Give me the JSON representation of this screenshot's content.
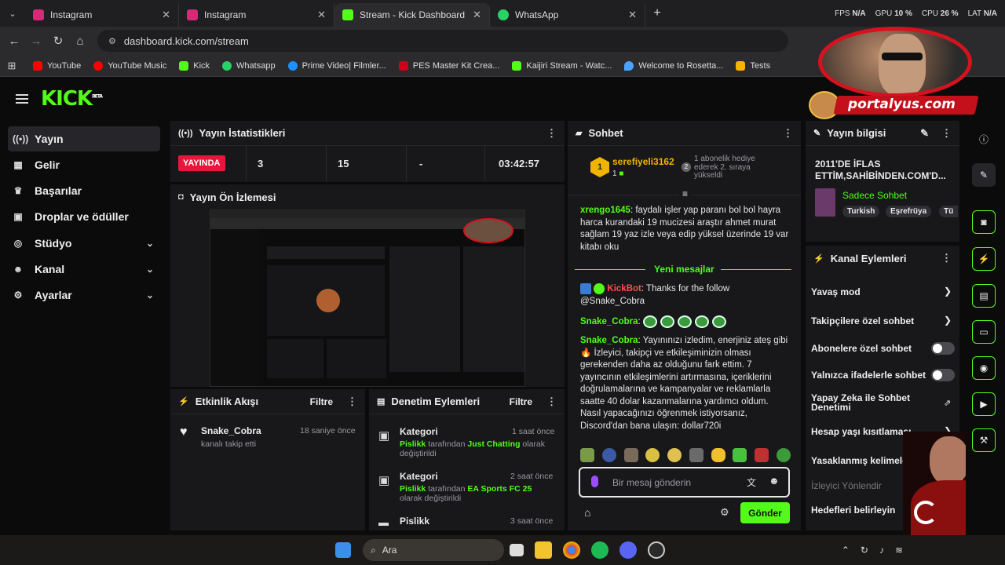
{
  "tabs": [
    {
      "label": "Instagram",
      "color": "#d62976"
    },
    {
      "label": "Instagram",
      "color": "#d62976"
    },
    {
      "label": "Stream - Kick Dashboard",
      "color": "#53fc18"
    },
    {
      "label": "WhatsApp",
      "color": "#25d366"
    }
  ],
  "system": {
    "fps_label": "FPS",
    "fps_value": "N/A",
    "gpu_label": "GPU",
    "gpu_value": "10 %",
    "cpu_label": "CPU",
    "cpu_value": "26 %",
    "lat_label": "LAT",
    "lat_value": "N/A"
  },
  "address": {
    "url": "dashboard.kick.com/stream"
  },
  "bookmarks": [
    {
      "label": "YouTube",
      "color": "#ff0000"
    },
    {
      "label": "YouTube Music",
      "color": "#ff0000"
    },
    {
      "label": "Kick",
      "color": "#53fc18"
    },
    {
      "label": "Whatsapp",
      "color": "#25d366"
    },
    {
      "label": "Prime Video| Filmler...",
      "color": "#1e90ff"
    },
    {
      "label": "PES Master Kit Crea...",
      "color": "#d0021b"
    },
    {
      "label": "Kaijiri Stream - Watc...",
      "color": "#53fc18"
    },
    {
      "label": "Welcome to Rosetta...",
      "color": "#4aa3ff"
    },
    {
      "label": "Tests",
      "color": "#f4b400"
    }
  ],
  "kick": {
    "logo": "KICK",
    "beta": "BETA"
  },
  "watermark": "portalyus.com",
  "sidebar": [
    {
      "label": "Yayın",
      "icon": "broadcast-icon",
      "glyph": "((•))",
      "chev": ""
    },
    {
      "label": "Gelir",
      "icon": "chart-icon",
      "glyph": "▦",
      "chev": ""
    },
    {
      "label": "Başarılar",
      "icon": "trophy-icon",
      "glyph": "🏆",
      "chev": ""
    },
    {
      "label": "Droplar ve ödüller",
      "icon": "gift-icon",
      "glyph": "▣",
      "chev": ""
    },
    {
      "label": "Stüdyo",
      "icon": "studio-icon",
      "glyph": "◎",
      "chev": "⌄"
    },
    {
      "label": "Kanal",
      "icon": "people-icon",
      "glyph": "👥",
      "chev": "⌄"
    },
    {
      "label": "Ayarlar",
      "icon": "gear-icon",
      "glyph": "⚙",
      "chev": "⌄"
    }
  ],
  "stats": {
    "title": "Yayın İstatistikleri",
    "status": "YAYINDA",
    "viewers": "3",
    "followers": "15",
    "subs": "-",
    "duration": "03:42:57"
  },
  "preview": {
    "title": "Yayın Ön İzlemesi"
  },
  "activity": {
    "title": "Etkinlik Akışı",
    "filter": "Filtre",
    "user": "Snake_Cobra",
    "action": "kanalı takip etti",
    "time": "18 saniye önce"
  },
  "moderation": {
    "title": "Denetim Eylemleri",
    "filter": "Filtre",
    "items": [
      {
        "title": "Kategori",
        "time": "1 saat önce",
        "actor": "Pislikk",
        "mid": " tarafından ",
        "target": "Just Chatting",
        "tail": " olarak",
        "line2": "değiştirildi"
      },
      {
        "title": "Kategori",
        "time": "2 saat önce",
        "actor": "Pislikk",
        "mid": " tarafından ",
        "target": "EA Sports FC 25",
        "tail": "",
        "line2": "olarak değiştirildi"
      },
      {
        "title": "Pislikk",
        "time": "3 saat önce"
      }
    ]
  },
  "chat": {
    "title": "Sohbet",
    "pinned_user": "serefiyeli3162",
    "pinned_count": "1",
    "pinned_badge": "2",
    "pinned_text": "1 abonelik hediye ederek 2. sıraya yükseldi",
    "msg1_user": "xrengo1645",
    "msg1_text": ": faydalı işler yap paranı bol bol hayra harca kurandaki 19 mucizesi araştır ahmet murat sağlam 19 yaz izle veya edip yüksel üzerinde 19 var kitabı oku",
    "new_messages": "Yeni mesajlar",
    "bot_user": "KickBot",
    "bot_text": ": Thanks for the follow @Snake_Cobra",
    "msg2_user": "Snake_Cobra",
    "msg3_user": "Snake_Cobra",
    "msg3_text": ": Yayınınızı izledim, enerjiniz ateş gibi 🔥 İzleyici, takipçi ve etkileşiminizin olması gerekenden daha az olduğunu fark ettim. 7 yayıncının etkileşimlerini artırmasına, içeriklerini doğrulamalarına ve kampanyalar ve reklamlarla saatte 40 dolar kazanmalarına yardımcı oldum. Nasıl yapacağınızı öğrenmek istiyorsanız, Discord'dan bana ulaşın: dollar720i",
    "placeholder": "Bir mesaj gönderin",
    "send": "Gönder"
  },
  "stream_info": {
    "title": "Yayın bilgisi",
    "stream_title": "2011'DE İFLAS ETTİM,SAHİBİNDEN.COM'D...",
    "category": "Sadece Sohbet",
    "tags": [
      "Turkish",
      "Eşrefrüya",
      "Tü"
    ]
  },
  "channel_actions": {
    "title": "Kanal Eylemleri",
    "items": [
      {
        "label": "Yavaş mod",
        "control": "chevron"
      },
      {
        "label": "Takipçilere özel sohbet",
        "control": "chevron"
      },
      {
        "label": "Abonelere özel sohbet",
        "control": "toggle"
      },
      {
        "label": "Yalnızca ifadelerle sohbet",
        "control": "toggle"
      },
      {
        "label": "Yapay Zeka ile Sohbet Denetimi",
        "control": "external"
      },
      {
        "label": "Hesap yaşı kısıtlaması",
        "control": "chevron"
      },
      {
        "label": "Yasaklanmış kelimeler",
        "control": "chevron"
      },
      {
        "label": "İzleyici Yönlendir",
        "control": "none"
      },
      {
        "label": "Hedefleri belirleyin",
        "control": "none"
      }
    ]
  },
  "taskbar": {
    "search": "Ara"
  }
}
